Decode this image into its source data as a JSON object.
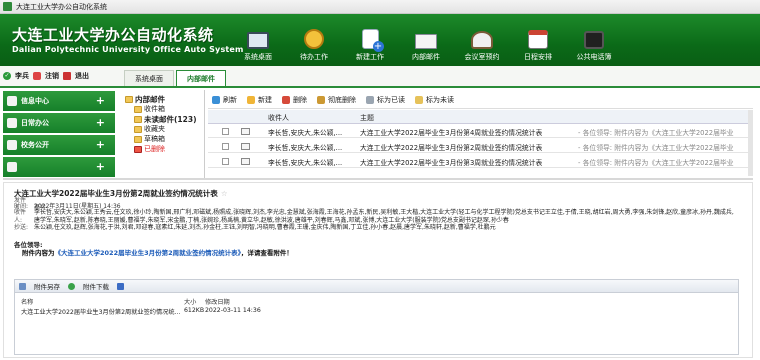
{
  "window": {
    "title": "大连工业大学办公自动化系统"
  },
  "header": {
    "logo_cn": "大连工业大学办公自动化系统",
    "logo_en": "Dalian Polytechnic University Office Auto System",
    "nav": [
      {
        "label": "系统桌面",
        "icon": "desktop-monitor-icon"
      },
      {
        "label": "待办工作",
        "icon": "alarm-clock-icon"
      },
      {
        "label": "新建工作",
        "icon": "new-document-icon"
      },
      {
        "label": "内部邮件",
        "icon": "envelope-icon"
      },
      {
        "label": "会议室预约",
        "icon": "people-meeting-icon"
      },
      {
        "label": "日程安排",
        "icon": "calendar-icon"
      },
      {
        "label": "公共电话簿",
        "icon": "phone-book-icon"
      }
    ]
  },
  "userbar": {
    "user": "李兵",
    "logout": "注销",
    "exit": "退出"
  },
  "tabs": [
    {
      "label": "系统桌面"
    },
    {
      "label": "内部邮件"
    }
  ],
  "sidebar": {
    "items": [
      {
        "label": "信息中心"
      },
      {
        "label": "日常办公"
      },
      {
        "label": "校务公开"
      },
      {
        "label": ""
      }
    ]
  },
  "tree": {
    "root": "内部邮件",
    "items": [
      "收件箱",
      "未读邮件(123)",
      "收藏夹",
      "草稿箱",
      "已删除"
    ]
  },
  "toolbar": {
    "refresh": "刷新",
    "new": "新建",
    "delete": "删除",
    "purge": "彻底删除",
    "mark_read": "标为已读",
    "mark_unread": "标为未读"
  },
  "list": {
    "col_recipient": "收件人",
    "col_subject": "主题",
    "rows": [
      {
        "recipient": "李长哲,安庆大,朱公颖,...",
        "subject": "大连工业大学2022届毕业生3月份第4周就业签约情况统计表",
        "preview": "- 各位领导: 附件内容为《大连工业大学2022届毕业"
      },
      {
        "recipient": "李长哲,安庆大,朱公颖,...",
        "subject": "大连工业大学2022届毕业生3月份第2周就业签约情况统计表",
        "preview": "- 各位领导: 附件内容为《大连工业大学2022届毕业"
      },
      {
        "recipient": "李长哲,安庆大,朱公颖,...",
        "subject": "大连工业大学2022届毕业生3月份第3周就业签约情况统计表",
        "preview": "- 各位领导: 附件内容为《大连工业大学2022届毕业"
      }
    ]
  },
  "reader": {
    "subject": "大连工业大学2022届毕业生3月份第2周就业签约情况统计表",
    "sender_label": "发件人:",
    "sender": "李兵",
    "time_label": "时间:",
    "time": "2022年3月11日(星期五) 14:36",
    "recipients_label": "收件人:",
    "recipients": "李长哲,安庆大,朱公颖,王秀云,任文玖,徐小玲,陶新国,邢广利,邓磁斌,杨照成,张晓辉,刘杰,李光忠,金慧斌,张海霞,王海花,孙孟东,新民,吴利敏,王大楷,大连工业大学(轻工与化学工程学院)党总支书记王立佳,于倩,王晓,胡红岩,周大勇,李强,朱剑锋,赵欣,童彦冰,孙丹,魏成兵,唐学军,朱晓军,赵新,陈春晓,王丽媛,曹福学,朱晓军,宋金鹏,丁楠,张婉珍,杨禹楠,黄立华,赵敏,徐洪波,唐雄平,刘春辉,马鑫,邓斌,张博,大连工业大学(服装学院)党总支副书记赵琛,孙少春",
    "cc_label": "抄送:",
    "cc": "朱公颖,任文玖,赵辉,张海花,于洪,刘君,邓迎春,寇素红,朱延,刘杰,孙金柱,王钰,刘明智,冯晓明,曹春霞,王珊,金庆伟,陶新国,丁立佳,孙小春,赵晨,唐学军,朱晓轩,赵新,曹福学,杜鹏元",
    "greeting": "各位领导:",
    "body_prefix": "附件内容为",
    "body_link": "《大连工业大学2022届毕业生3月份第2周就业签约情况统计表》",
    "body_suffix": "，详请查看附件！",
    "attachments": {
      "save_all": "附件另存",
      "download_all": "附件下载",
      "col_name": "名称",
      "col_size": "大小",
      "col_time": "修改日期",
      "files": [
        {
          "name": "大连工业大学2022届毕业生3月份第2周就业签约情况统...",
          "size": "612KB",
          "time": "2022-03-11 14:36"
        }
      ]
    }
  },
  "colors": {
    "brand_green": "#0b6a18",
    "accent_green": "#2a8c38",
    "link_blue": "#1a5ab8"
  }
}
